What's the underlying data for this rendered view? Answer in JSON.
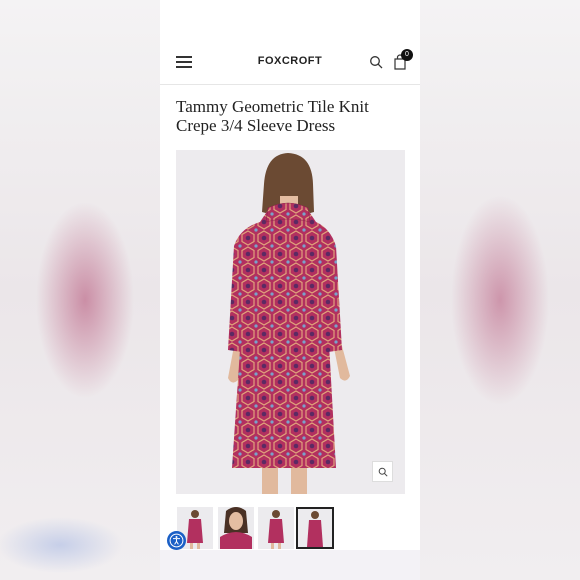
{
  "header": {
    "logo": "FOXCROFT",
    "cart_count": "0",
    "icons": [
      "menu-icon",
      "search-icon",
      "shopping-bag-icon"
    ]
  },
  "product": {
    "title_line1": "Tammy Geometric Tile Knit",
    "title_line2": "Crepe 3/4 Sleeve Dress"
  },
  "gallery": {
    "zoom_icon": "magnifier-icon",
    "thumbnail_count": 4,
    "active_thumbnail": 4
  },
  "colors": {
    "accent": "#1a5fc6",
    "dress_primary": "#b2305f",
    "dress_secondary": "#e0a27a"
  }
}
